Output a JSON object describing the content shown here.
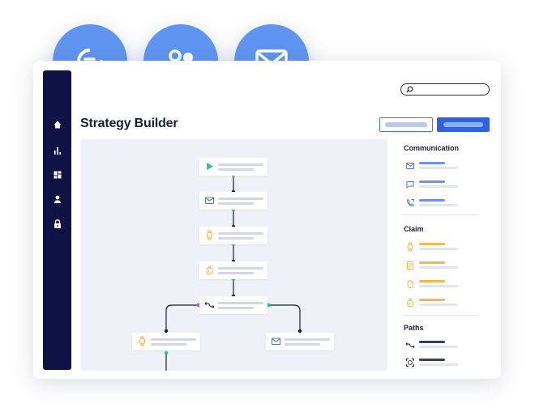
{
  "header": {
    "title": "Strategy Builder"
  },
  "search": {
    "icon": "search-icon",
    "value": ""
  },
  "sidebar": {
    "items": [
      {
        "icon": "home-icon"
      },
      {
        "icon": "bar-chart-icon"
      },
      {
        "icon": "dashboard-icon"
      },
      {
        "icon": "user-icon"
      },
      {
        "icon": "lock-icon"
      }
    ]
  },
  "bubbles": [
    {
      "icon": "chat-icon"
    },
    {
      "icon": "users-icon"
    },
    {
      "icon": "mail-icon"
    }
  ],
  "flow": {
    "nodes": [
      {
        "icon": "play-icon"
      },
      {
        "icon": "mail-icon"
      },
      {
        "icon": "watch-icon"
      },
      {
        "icon": "moneybag-icon"
      },
      {
        "icon": "split-path-icon"
      },
      {
        "icon": "watch-icon"
      },
      {
        "icon": "mail-icon"
      }
    ]
  },
  "panel": {
    "communication": {
      "title": "Communication",
      "items": [
        {
          "icon": "mail-icon"
        },
        {
          "icon": "chat-icon"
        },
        {
          "icon": "phone-icon"
        }
      ]
    },
    "claim": {
      "title": "Claim",
      "items": [
        {
          "icon": "watch-icon"
        },
        {
          "icon": "receipt-icon"
        },
        {
          "icon": "hand-icon"
        },
        {
          "icon": "moneybag-icon"
        }
      ]
    },
    "paths": {
      "title": "Paths",
      "items": [
        {
          "icon": "split-path-icon"
        },
        {
          "icon": "scan-face-icon"
        }
      ]
    }
  },
  "colors": {
    "sidebar": "#0f1245",
    "accent": "#2f63d8",
    "bubble": "#5f95f0",
    "communication": "#6d93ee",
    "claim": "#f2b94e",
    "paths": "#3b3f55",
    "connector_green": "#2ec38a",
    "connector_pink": "#e94aa1"
  }
}
